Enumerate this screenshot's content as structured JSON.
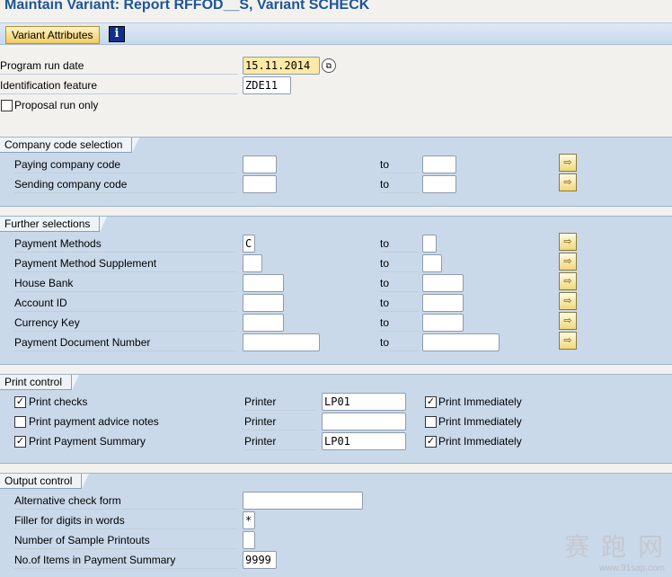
{
  "title": "Maintain Variant: Report RFFOD__S, Variant SCHECK",
  "toolbar": {
    "variant_attributes_label": "Variant Attributes",
    "info_glyph": "i"
  },
  "top": {
    "program_run_date_label": "Program run date",
    "program_run_date_value": "15.11.2014",
    "identification_label": "Identification feature",
    "identification_value": "ZDE11",
    "proposal_label": "Proposal run only",
    "proposal_checked": false
  },
  "company_section": {
    "title": "Company code selection",
    "to_label": "to",
    "rows": [
      {
        "label": "Paying company code",
        "from": "",
        "to": ""
      },
      {
        "label": "Sending company code",
        "from": "",
        "to": ""
      }
    ]
  },
  "further_section": {
    "title": "Further selections",
    "to_label": "to",
    "rows": [
      {
        "label": "Payment Methods",
        "from": "C",
        "to": ""
      },
      {
        "label": "Payment Method Supplement",
        "from": "",
        "to": ""
      },
      {
        "label": "House Bank",
        "from": "",
        "to": ""
      },
      {
        "label": "Account ID",
        "from": "",
        "to": ""
      },
      {
        "label": "Currency Key",
        "from": "",
        "to": ""
      },
      {
        "label": "Payment Document Number",
        "from": "",
        "to": ""
      }
    ]
  },
  "print_section": {
    "title": "Print control",
    "printer_label": "Printer",
    "immediately_label": "Print Immediately",
    "rows": [
      {
        "label": "Print checks",
        "checked": true,
        "printer": "LP01",
        "immediate": true
      },
      {
        "label": "Print payment advice notes",
        "checked": false,
        "printer": "",
        "immediate": false
      },
      {
        "label": "Print Payment Summary",
        "checked": true,
        "printer": "LP01",
        "immediate": true
      }
    ]
  },
  "output_section": {
    "title": "Output control",
    "rows": [
      {
        "label": "Alternative check form",
        "value": ""
      },
      {
        "label": "Filler for digits in words",
        "value": "*"
      },
      {
        "label": "Number of Sample Printouts",
        "value": ""
      },
      {
        "label": "No.of Items in Payment Summary",
        "value": "9999"
      }
    ]
  },
  "watermark": {
    "text": "赛 跑 网",
    "url": "www.91sap.com"
  }
}
